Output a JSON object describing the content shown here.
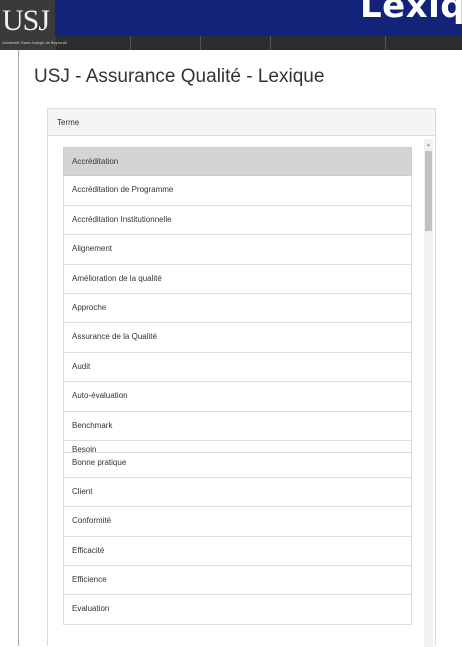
{
  "banner": {
    "title": "Lexique"
  },
  "logo": {
    "text": "USJ",
    "caption": "Université Saint-Joseph de Beyrouth"
  },
  "page": {
    "title": "USJ - Assurance Qualité - Lexique"
  },
  "panel": {
    "header": "Terme",
    "items": [
      "Accréditation",
      "Accréditation de Programme",
      "Accréditation Institutionnelle",
      "Alignement",
      "Amélioration de la qualité",
      "Approche",
      "Assurance de la Qualité",
      "Audit",
      "Auto-évaluation",
      "Benchmark",
      "Besoin",
      "Bonne pratique",
      "Client",
      "Conformité",
      "Efficacité",
      "Efficience",
      "Evaluation"
    ],
    "active_index": 0
  },
  "colors": {
    "banner_bg": "#13237a",
    "topbar_bg": "#2d2d2d",
    "active_row": "#d4d4d4"
  }
}
